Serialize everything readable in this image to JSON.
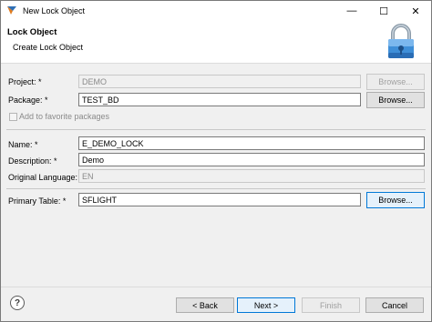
{
  "window": {
    "title": "New Lock Object",
    "minimize_glyph": "—",
    "maximize_glyph": "☐",
    "close_glyph": "✕"
  },
  "header": {
    "title": "Lock Object",
    "subtitle": "Create Lock Object"
  },
  "form": {
    "project": {
      "label": "Project: *",
      "value": "DEMO",
      "browse": "Browse..."
    },
    "package": {
      "label": "Package: *",
      "value": "TEST_BD",
      "browse": "Browse..."
    },
    "favorite": {
      "label": "Add to favorite packages",
      "checked": false
    },
    "name": {
      "label": "Name: *",
      "value": "E_DEMO_LOCK"
    },
    "description": {
      "label": "Description: *",
      "value": "Demo"
    },
    "original_language": {
      "label": "Original Language:",
      "value": "EN"
    },
    "primary_table": {
      "label": "Primary Table: *",
      "value": "SFLIGHT",
      "browse": "Browse..."
    }
  },
  "footer": {
    "help_glyph": "?",
    "back": "< Back",
    "next": "Next >",
    "finish": "Finish",
    "cancel": "Cancel"
  },
  "icons": [
    "app-icon",
    "lock-icon",
    "help-icon"
  ],
  "colors": {
    "focus_border": "#0078d7",
    "disabled_text": "#8a8a8a"
  }
}
